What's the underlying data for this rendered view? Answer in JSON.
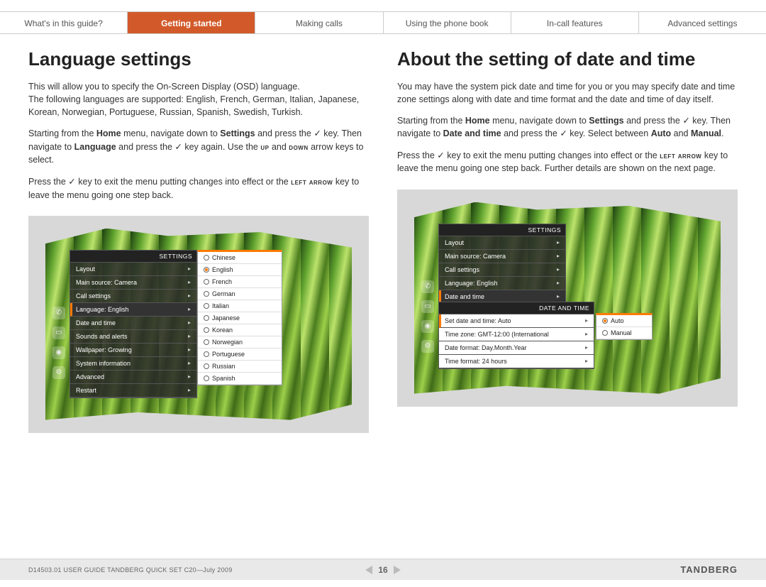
{
  "nav": {
    "items": [
      "What's in this guide?",
      "Getting started",
      "Making calls",
      "Using the phone book",
      "In-call features",
      "Advanced settings"
    ],
    "activeIndex": 1
  },
  "left": {
    "heading": "Language settings",
    "p1a": "This will allow you to specify the On-Screen Display (OSD) language.",
    "p1b": "The following languages are supported: English, French, German, Italian, Japanese, Korean, Norwegian, Portuguese, Russian, Spanish, Swedish, Turkish.",
    "p2a": "Starting from the ",
    "p2b": "Home",
    "p2c": " menu, navigate down to ",
    "p2d": "Settings",
    "p2e": " and press the ",
    "p2f": " key. Then navigate to ",
    "p2g": "Language",
    "p2h": " and press the ",
    "p2i": " key again. Use the ",
    "p2j": "up",
    "p2k": " and ",
    "p2l": "down",
    "p2m": " arrow keys to select.",
    "p3a": "Press the ",
    "p3b": " key to exit the menu putting changes into effect or the ",
    "p3c": "left arrow",
    "p3d": " key to leave the menu going one step back.",
    "screenshot": {
      "header": "SETTINGS",
      "rows": [
        "Layout",
        "Main source: Camera",
        "Call settings",
        "Language: English",
        "Date and time",
        "Sounds and alerts",
        "Wallpaper: Growing",
        "System information",
        "Advanced",
        "Restart"
      ],
      "selectedIndex": 3,
      "langs": [
        "Chinese",
        "English",
        "French",
        "German",
        "Italian",
        "Japanese",
        "Korean",
        "Norwegian",
        "Portuguese",
        "Russian",
        "Spanish"
      ],
      "langSelectedIndex": 1
    }
  },
  "right": {
    "heading": "About the setting of date and time",
    "p1": "You may have the system pick date and time for you or you may specify date and time zone settings along with date and time format and the date and time of day itself.",
    "p2a": "Starting from the ",
    "p2b": "Home",
    "p2c": " menu, navigate down to ",
    "p2d": "Settings",
    "p2e": " and press the ",
    "p2f": " key. Then navigate to ",
    "p2g": "Date and time",
    "p2h": " and press the ",
    "p2i": " key. Select between ",
    "p2j": "Auto",
    "p2k": " and ",
    "p2l": "Manual",
    "p2m": ".",
    "p3a": "Press the ",
    "p3b": " key to exit the menu putting changes into effect or the ",
    "p3c": "left arrow",
    "p3d": " key to leave the menu going one step back. Further details are shown on the next page.",
    "screenshot": {
      "header": "SETTINGS",
      "rows": [
        "Layout",
        "Main source: Camera",
        "Call settings",
        "Language: English",
        "Date and time"
      ],
      "selectedIndex": 4,
      "subHeader": "DATE AND TIME",
      "subRows": [
        "Set date and time: Auto",
        "Time zone: GMT-12:00 (International",
        "Date format: Day.Month.Year",
        "Time format: 24 hours"
      ],
      "subSelectedIndex": 0,
      "options": [
        "Auto",
        "Manual"
      ],
      "optionSelectedIndex": 0
    }
  },
  "footer": {
    "docid": "D14503.01 USER GUIDE TANDBERG QUICK SET C20—July 2009",
    "page": "16",
    "brand": "TANDBERG"
  },
  "glyphs": {
    "check": "✓"
  }
}
